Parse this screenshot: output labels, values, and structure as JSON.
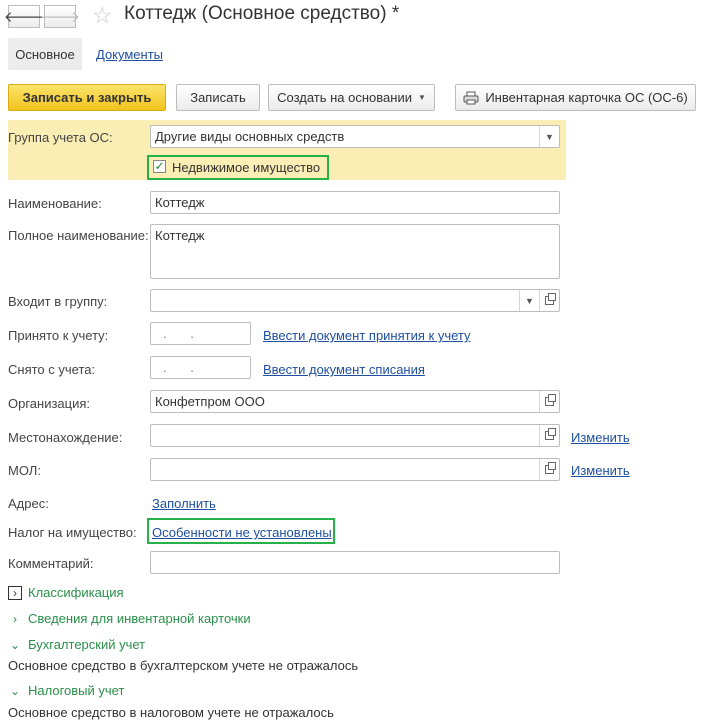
{
  "header": {
    "back_icon": "arrow-left-icon",
    "forward_icon": "arrow-right-icon",
    "favorite_icon": "star-icon",
    "title": "Коттедж (Основное средство) *"
  },
  "tabs": {
    "main": "Основное",
    "documents": "Документы"
  },
  "toolbar": {
    "save_close": "Записать и закрыть",
    "save": "Записать",
    "create_based": "Создать на основании",
    "inventory_card": "Инвентарная карточка ОС (ОС-6)"
  },
  "form": {
    "group_label": "Группа учета ОС:",
    "group_value": "Другие виды основных средств",
    "real_estate_label": "Недвижимое имущество",
    "real_estate_checked": true,
    "name_label": "Наименование:",
    "name_value": "Коттедж",
    "full_name_label": "Полное наименование:",
    "full_name_value": "Коттедж",
    "parent_group_label": "Входит в группу:",
    "parent_group_value": "",
    "accepted_label": "Принято к учету:",
    "accepted_value": " .  .",
    "accepted_link": "Ввести документ принятия к учету",
    "removed_label": "Снято с учета:",
    "removed_value": " .  .",
    "removed_link": "Ввести документ списания",
    "org_label": "Организация:",
    "org_value": "Конфетпром ООО",
    "location_label": "Местонахождение:",
    "location_value": "",
    "location_link": "Изменить",
    "mol_label": "МОЛ:",
    "mol_value": "",
    "mol_link": "Изменить",
    "address_label": "Адрес:",
    "address_link": "Заполнить",
    "tax_label": "Налог на имущество:",
    "tax_link": "Особенности не установлены",
    "comment_label": "Комментарий:",
    "comment_value": ""
  },
  "sections": {
    "classification": "Классификация",
    "inventory_info": "Сведения для инвентарной карточки",
    "accounting": "Бухгалтерский учет",
    "accounting_text": "Основное средство в бухгалтерском учете не отражалось",
    "tax": "Налоговый учет",
    "tax_text": "Основное средство в налоговом учете не отражалось"
  },
  "colors": {
    "accent_yellow": "#f2c31d",
    "highlight_green": "#27b14a",
    "link_blue": "#1f4fa0",
    "section_green": "#2a8f4a"
  }
}
